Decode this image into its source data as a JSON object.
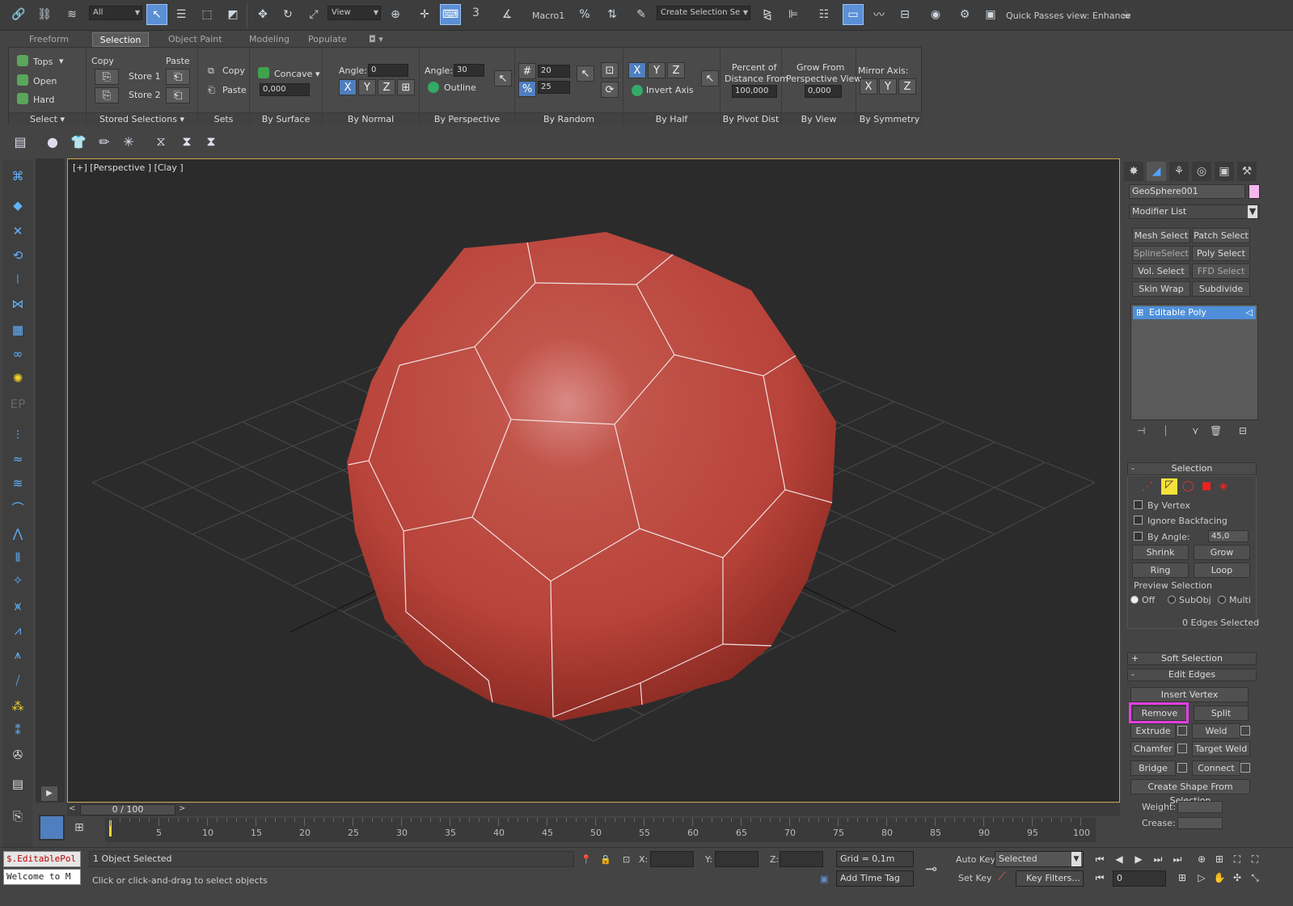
{
  "toolbar": {
    "selection_filter": "All",
    "ref_coord": "View",
    "snap_label": "3",
    "macro_label": "Macro1",
    "named_selection_placeholder": "Create Selection Se",
    "quick_passes": "Quick Passes  view: Enhance"
  },
  "ribbon": {
    "tabs": [
      "Freeform",
      "Selection",
      "Object Paint",
      "Modeling",
      "Populate"
    ],
    "active_tab": "Selection",
    "select_group": {
      "items": [
        "Tops",
        "Open",
        "Hard"
      ],
      "label": "Select"
    },
    "stored_group": {
      "copy": "Copy",
      "paste": "Paste",
      "store1": "Store 1",
      "store2": "Store 2",
      "label": "Stored Selections"
    },
    "sets_group": {
      "copy": "Copy",
      "paste": "Paste",
      "label": "Sets"
    },
    "surface_group": {
      "mode": "Concave",
      "value": "0,000",
      "label": "By Surface"
    },
    "normal_group": {
      "angle_label": "Angle:",
      "angle_value": "0",
      "axes": [
        "X",
        "Y",
        "Z"
      ],
      "label": "By Normal"
    },
    "perspective_group": {
      "angle_label": "Angle:",
      "angle_value": "30",
      "outline": "Outline",
      "label": "By Perspective"
    },
    "random_group": {
      "count": "20",
      "percent": "25",
      "label": "By Random"
    },
    "half_group": {
      "axes": [
        "X",
        "Y",
        "Z"
      ],
      "invert": "Invert Axis",
      "label": "By Half"
    },
    "pivot_group": {
      "title_line1": "Percent of",
      "title_line2": "Distance From",
      "value": "100,000",
      "label": "By Pivot Dist"
    },
    "view_group": {
      "title_line1": "Grow From",
      "title_line2": "Perspective View",
      "value": "0,000",
      "label": "By View"
    },
    "symmetry_group": {
      "title": "Mirror Axis:",
      "axes": [
        "X",
        "Y",
        "Z"
      ],
      "label": "By Symmetry"
    }
  },
  "viewport": {
    "label": "[+] [Perspective ] [Clay ]",
    "object_color": "#b8433a",
    "wire_color": "#f0e0e0"
  },
  "command_panel": {
    "object_name": "GeoSphere001",
    "object_color": "#f5b6ee",
    "modifier_list": "Modifier List",
    "modifier_buttons": [
      "Mesh Select",
      "Patch Select",
      "SplineSelect",
      "Poly Select",
      "Vol. Select",
      "FFD Select",
      "Skin Wrap",
      "Subdivide"
    ],
    "stack_item": "Editable Poly",
    "selection": {
      "title": "Selection",
      "by_vertex": "By Vertex",
      "ignore_backfacing": "Ignore Backfacing",
      "by_angle": "By Angle:",
      "angle_value": "45,0",
      "shrink": "Shrink",
      "grow": "Grow",
      "ring": "Ring",
      "loop": "Loop",
      "preview_title": "Preview Selection",
      "preview_options": [
        "Off",
        "SubObj",
        "Multi"
      ],
      "status": "0 Edges Selected"
    },
    "soft_selection": "Soft Selection",
    "edit_edges": {
      "title": "Edit Edges",
      "insert_vertex": "Insert Vertex",
      "remove": "Remove",
      "split": "Split",
      "extrude": "Extrude",
      "weld": "Weld",
      "chamfer": "Chamfer",
      "target_weld": "Target Weld",
      "bridge": "Bridge",
      "connect": "Connect",
      "create_shape": "Create Shape From Selection",
      "weight": "Weight:",
      "crease": "Crease:"
    }
  },
  "timeline": {
    "frame": "0 / 100",
    "ticks": [
      "5",
      "10",
      "15",
      "20",
      "25",
      "30",
      "35",
      "40",
      "45",
      "50",
      "55",
      "60",
      "65",
      "70",
      "75",
      "80",
      "85",
      "90",
      "95",
      "100"
    ]
  },
  "status": {
    "script_line1": "$.EditablePol",
    "script_line2": "Welcome to M",
    "selected": "1 Object Selected",
    "prompt": "Click or click-and-drag to select objects",
    "x_label": "X:",
    "y_label": "Y:",
    "z_label": "Z:",
    "grid": "Grid = 0,1m",
    "add_time_tag": "Add Time Tag",
    "auto_key": "Auto Key",
    "set_key": "Set Key",
    "key_mode": "Selected",
    "key_filters": "Key Filters...",
    "current_frame": "0"
  }
}
